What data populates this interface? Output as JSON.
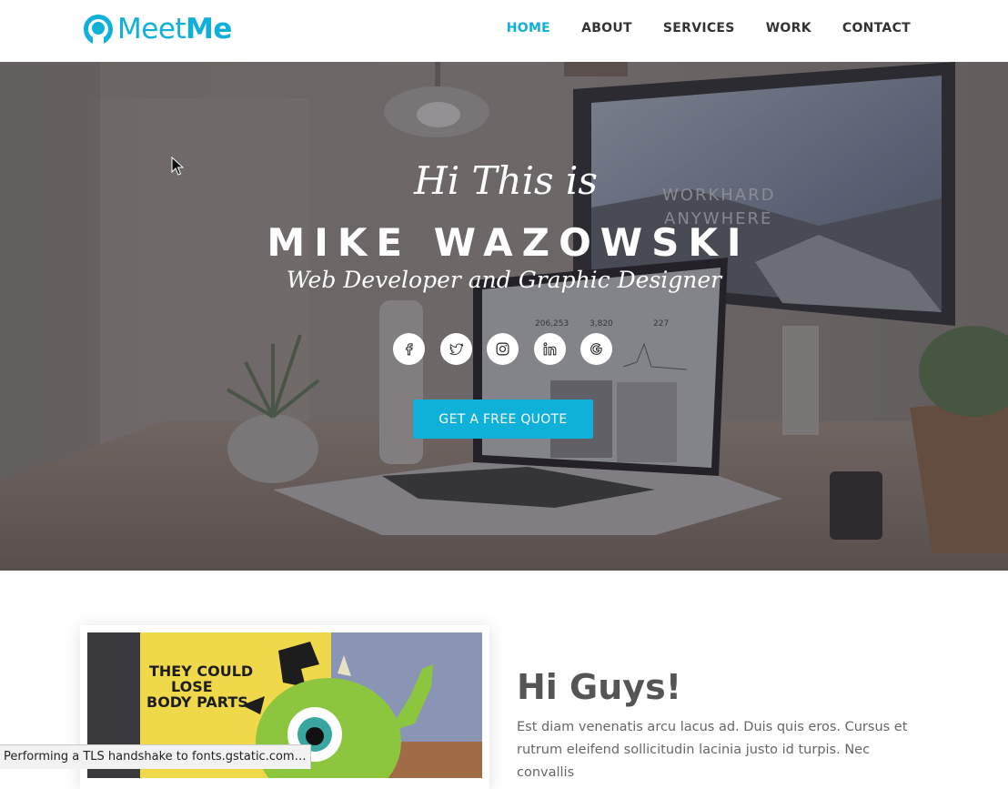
{
  "brand": {
    "name_light": "Meet",
    "name_bold": "Me",
    "accent": "#0fb1d8",
    "icon": "person-silhouette-icon"
  },
  "nav": [
    {
      "label": "HOME",
      "active": true
    },
    {
      "label": "ABOUT",
      "active": false
    },
    {
      "label": "SERVICES",
      "active": false
    },
    {
      "label": "WORK",
      "active": false
    },
    {
      "label": "CONTACT",
      "active": false
    }
  ],
  "hero": {
    "greeting": "Hi This is",
    "name": "MIKE WAZOWSKI",
    "role": "Web Developer and Graphic Designer",
    "socials": [
      "facebook-icon",
      "twitter-icon",
      "instagram-icon",
      "linkedin-icon",
      "google-icon"
    ],
    "cta_label": "GET A FREE QUOTE",
    "cta_color": "#0fb1d8",
    "photo_screen_text": [
      "WORKHARD",
      "ANYWHERE"
    ],
    "photo_stats": [
      "206,253",
      "3,820",
      "227"
    ]
  },
  "about": {
    "title": "Hi Guys!",
    "body": "Est diam venenatis arcu lacus ad. Duis quis eros. Cursus et rutrum eleifend sollicitudin lacinia justo id turpis. Nec convallis",
    "image_sign": [
      "THEY COULD",
      "LOSE",
      "BODY PARTS"
    ]
  },
  "status_bar": "Performing a TLS handshake to fonts.gstatic.com…"
}
